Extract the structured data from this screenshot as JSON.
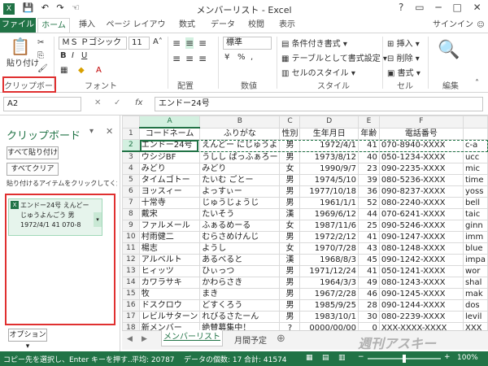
{
  "title": "メンバーリスト - Excel",
  "tabs": [
    "ファイル",
    "ホーム",
    "挿入",
    "ページ レイアウト",
    "数式",
    "データ",
    "校閲",
    "表示"
  ],
  "signin": "サインイン",
  "ribbon": {
    "paste": "貼り付け",
    "font_name": "ＭＳ Ｐゴシック",
    "font_size": "11",
    "number_format": "標準",
    "cond_format": "条件付き書式 ▾",
    "table_format": "テーブルとして書式設定 ▾",
    "cell_style": "セルのスタイル ▾",
    "insert": "挿入 ▾",
    "delete": "削除 ▾",
    "format": "書式 ▾",
    "groups": [
      "クリップボード",
      "フォント",
      "配置",
      "数値",
      "スタイル",
      "セル",
      "編集"
    ],
    "bold": "B",
    "italic": "I",
    "underline": "U",
    "percent": "%",
    "comma": ","
  },
  "namebox": "A2",
  "formula": "エンドー24号",
  "fx": "fx",
  "clipboard_pane": {
    "title": "クリップボード",
    "paste_all": "すべて貼り付け",
    "clear_all": "すべてクリア",
    "hint": "貼り付けるアイテムをクリックしてくださ",
    "item": [
      "エンドー24号 えんどー",
      "じゅうよんごう 男",
      "1972/4/1 41 070-8"
    ],
    "options": "オプション ▾"
  },
  "columns": [
    "A",
    "B",
    "C",
    "D",
    "E",
    "F"
  ],
  "header": [
    "コードネーム",
    "ふりがな",
    "性別",
    "生年月日",
    "年齢",
    "電話番号"
  ],
  "rows": [
    [
      "エンドー24号",
      "えんどー にじゅうよ",
      "男",
      "1972/4/1",
      "41",
      "070-8940-XXXX",
      "c-a"
    ],
    [
      "ウシジBF",
      "うしし ぱっふぁろー",
      "男",
      "1973/8/12",
      "40",
      "050-1234-XXXX",
      "ucc"
    ],
    [
      "みどり",
      "みどり",
      "女",
      "1990/9/7",
      "23",
      "090-2235-XXXX",
      "mic"
    ],
    [
      "タイムゴトー",
      "たいむ ごとー",
      "男",
      "1974/5/10",
      "39",
      "080-5236-XXXX",
      "time"
    ],
    [
      "ヨッスィー",
      "よっすぃー",
      "男",
      "1977/10/18",
      "36",
      "090-8237-XXXX",
      "yoss"
    ],
    [
      "十常寺",
      "じゅうじょうじ",
      "男",
      "1961/1/1",
      "52",
      "080-2240-XXXX",
      "bell"
    ],
    [
      "戴宋",
      "たいそう",
      "漢",
      "1969/6/12",
      "44",
      "070-6241-XXXX",
      "taic"
    ],
    [
      "ファルメール",
      "ふぁるめーる",
      "女",
      "1987/11/6",
      "25",
      "090-5246-XXXX",
      "ginn"
    ],
    [
      "村雨健二",
      "むらさめけんじ",
      "男",
      "1972/2/12",
      "41",
      "090-1247-XXXX",
      "imm"
    ],
    [
      "楊志",
      "ようし",
      "女",
      "1970/7/28",
      "43",
      "080-1248-XXXX",
      "blue"
    ],
    [
      "アルベルト",
      "あるべると",
      "漢",
      "1968/8/3",
      "45",
      "090-1242-XXXX",
      "impa"
    ],
    [
      "ヒィッツ",
      "ひぃっつ",
      "男",
      "1971/12/24",
      "41",
      "050-1241-XXXX",
      "wor"
    ],
    [
      "カワラサキ",
      "かわらさき",
      "男",
      "1964/3/3",
      "49",
      "080-1243-XXXX",
      "shal"
    ],
    [
      "牧",
      "まき",
      "男",
      "1967/2/28",
      "46",
      "090-1245-XXXX",
      "mak"
    ],
    [
      "ドスクロウ",
      "どすくろう",
      "男",
      "1985/9/25",
      "28",
      "090-1244-XXXX",
      "dos"
    ],
    [
      "レビルサターン",
      "れびるさたーん",
      "男",
      "1983/10/1",
      "30",
      "080-2239-XXXX",
      "levil"
    ],
    [
      "新メンバー",
      "絶賛募集中！",
      "?",
      "0000/00/00",
      "0",
      "XXX-XXXX-XXXX",
      "XXX"
    ]
  ],
  "sheet_tabs": [
    "メンバーリスト",
    "月間予定"
  ],
  "status": {
    "message": "コピー先を選択し、Enter キーを押す...",
    "average": "平均: 20787",
    "count": "データの個数: 17",
    "sum": "合計: 41574",
    "zoom": "100%"
  },
  "watermark": "週刊アスキー",
  "colors": {
    "accent": "#217346",
    "highlight": "#e03030"
  }
}
